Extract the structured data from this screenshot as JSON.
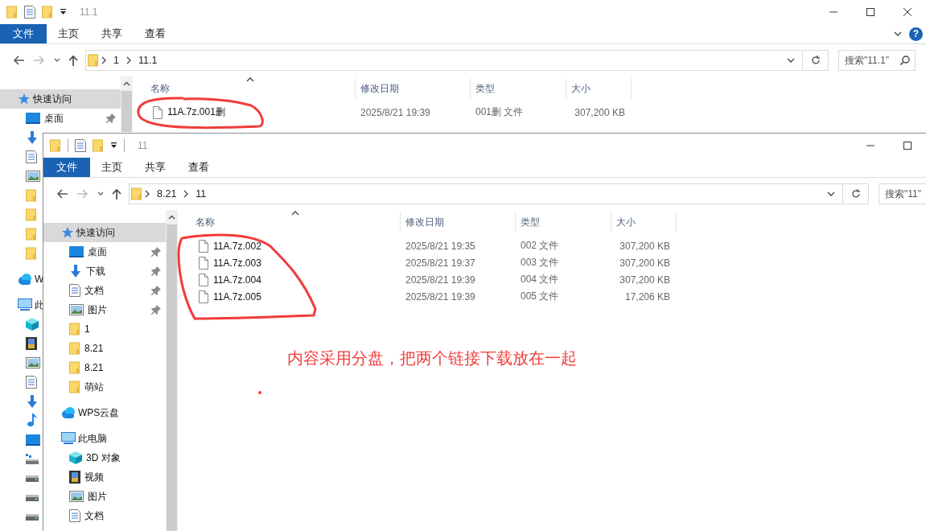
{
  "windows": [
    {
      "title": "11.1",
      "ribbon_tabs": [
        {
          "label": "文件",
          "kind": "file"
        },
        {
          "label": "主页",
          "kind": "tab"
        },
        {
          "label": "共享",
          "kind": "tab"
        },
        {
          "label": "查看",
          "kind": "tab"
        }
      ],
      "help_button": {
        "label": "?"
      },
      "address": {
        "path": [
          "1",
          "11.1"
        ]
      },
      "search": {
        "placeholder": "搜索\"11.1\""
      },
      "sidebar": {
        "items": [
          {
            "label": "快速访问",
            "kind": "star",
            "selected": true,
            "children": [
              {
                "label": "桌面",
                "kind": "desktop",
                "pinned": true,
                "selected": false
              },
              {
                "kind": "download",
                "pinned": false,
                "selected": false
              },
              {
                "kind": "documents",
                "pinned": false,
                "selected": false
              },
              {
                "kind": "pictures",
                "pinned": false,
                "selected": false
              },
              {
                "kind": "folder",
                "pinned": false,
                "selected": false
              },
              {
                "kind": "folder",
                "pinned": false,
                "selected": false
              },
              {
                "kind": "folder",
                "pinned": false,
                "selected": false
              },
              {
                "kind": "folder",
                "pinned": false,
                "selected": false
              }
            ]
          },
          {
            "label": "W",
            "kind": "cloud",
            "selected": false
          },
          {
            "label": "此",
            "kind": "pc",
            "selected": false,
            "children": [
              {
                "kind": "cube",
                "selected": false
              },
              {
                "kind": "video",
                "selected": false
              },
              {
                "kind": "pictures",
                "selected": false
              },
              {
                "kind": "documents",
                "selected": false
              },
              {
                "kind": "download",
                "selected": false
              },
              {
                "kind": "music",
                "selected": false
              },
              {
                "kind": "desktop",
                "selected": false
              },
              {
                "kind": "netdrive",
                "selected": false
              },
              {
                "kind": "drive",
                "selected": false
              },
              {
                "kind": "drive",
                "selected": false
              },
              {
                "kind": "drive",
                "selected": false
              }
            ]
          }
        ]
      },
      "columns": [
        "名称",
        "修改日期",
        "类型",
        "大小"
      ],
      "files": [
        {
          "name": "11A.7z.001删",
          "modified": "2025/8/21 19:39",
          "type": "001删 文件",
          "size": "307,200 KB"
        }
      ]
    },
    {
      "title": "11",
      "ribbon_tabs": [
        {
          "label": "文件",
          "kind": "file"
        },
        {
          "label": "主页",
          "kind": "tab"
        },
        {
          "label": "共享",
          "kind": "tab"
        },
        {
          "label": "查看",
          "kind": "tab"
        }
      ],
      "address": {
        "path": [
          "8.21",
          "11"
        ]
      },
      "search": {
        "placeholder": "搜索\"11\""
      },
      "sidebar": {
        "items": [
          {
            "label": "快速访问",
            "kind": "star",
            "selected": true,
            "children": [
              {
                "label": "桌面",
                "kind": "desktop",
                "pinned": true,
                "selected": false
              },
              {
                "label": "下载",
                "kind": "download",
                "pinned": true,
                "selected": false
              },
              {
                "label": "文档",
                "kind": "documents",
                "pinned": true,
                "selected": false
              },
              {
                "label": "图片",
                "kind": "pictures",
                "pinned": true,
                "selected": false
              },
              {
                "label": "1",
                "kind": "folder",
                "pinned": false,
                "selected": false
              },
              {
                "label": "8.21",
                "kind": "folder",
                "pinned": false,
                "selected": false
              },
              {
                "label": "8.21",
                "kind": "folder",
                "pinned": false,
                "selected": false
              },
              {
                "label": "萌站",
                "kind": "folder",
                "pinned": false,
                "selected": false
              }
            ]
          },
          {
            "label": "WPS云盘",
            "kind": "cloud",
            "selected": false
          },
          {
            "label": "此电脑",
            "kind": "pc",
            "selected": false,
            "children": [
              {
                "label": "3D 对象",
                "kind": "cube",
                "selected": false
              },
              {
                "label": "视频",
                "kind": "video",
                "selected": false
              },
              {
                "label": "图片",
                "kind": "pictures",
                "selected": false
              },
              {
                "label": "文档",
                "kind": "documents",
                "selected": false
              }
            ]
          }
        ]
      },
      "columns": [
        "名称",
        "修改日期",
        "类型",
        "大小"
      ],
      "files": [
        {
          "name": "11A.7z.002",
          "modified": "2025/8/21 19:35",
          "type": "002 文件",
          "size": "307,200 KB"
        },
        {
          "name": "11A.7z.003",
          "modified": "2025/8/21 19:37",
          "type": "003 文件",
          "size": "307,200 KB"
        },
        {
          "name": "11A.7z.004",
          "modified": "2025/8/21 19:39",
          "type": "004 文件",
          "size": "307,200 KB"
        },
        {
          "name": "11A.7z.005",
          "modified": "2025/8/21 19:39",
          "type": "005 文件",
          "size": "17,206 KB"
        }
      ]
    }
  ],
  "annotation": {
    "note": "内容采用分盘，把两个链接下载放在一起"
  }
}
